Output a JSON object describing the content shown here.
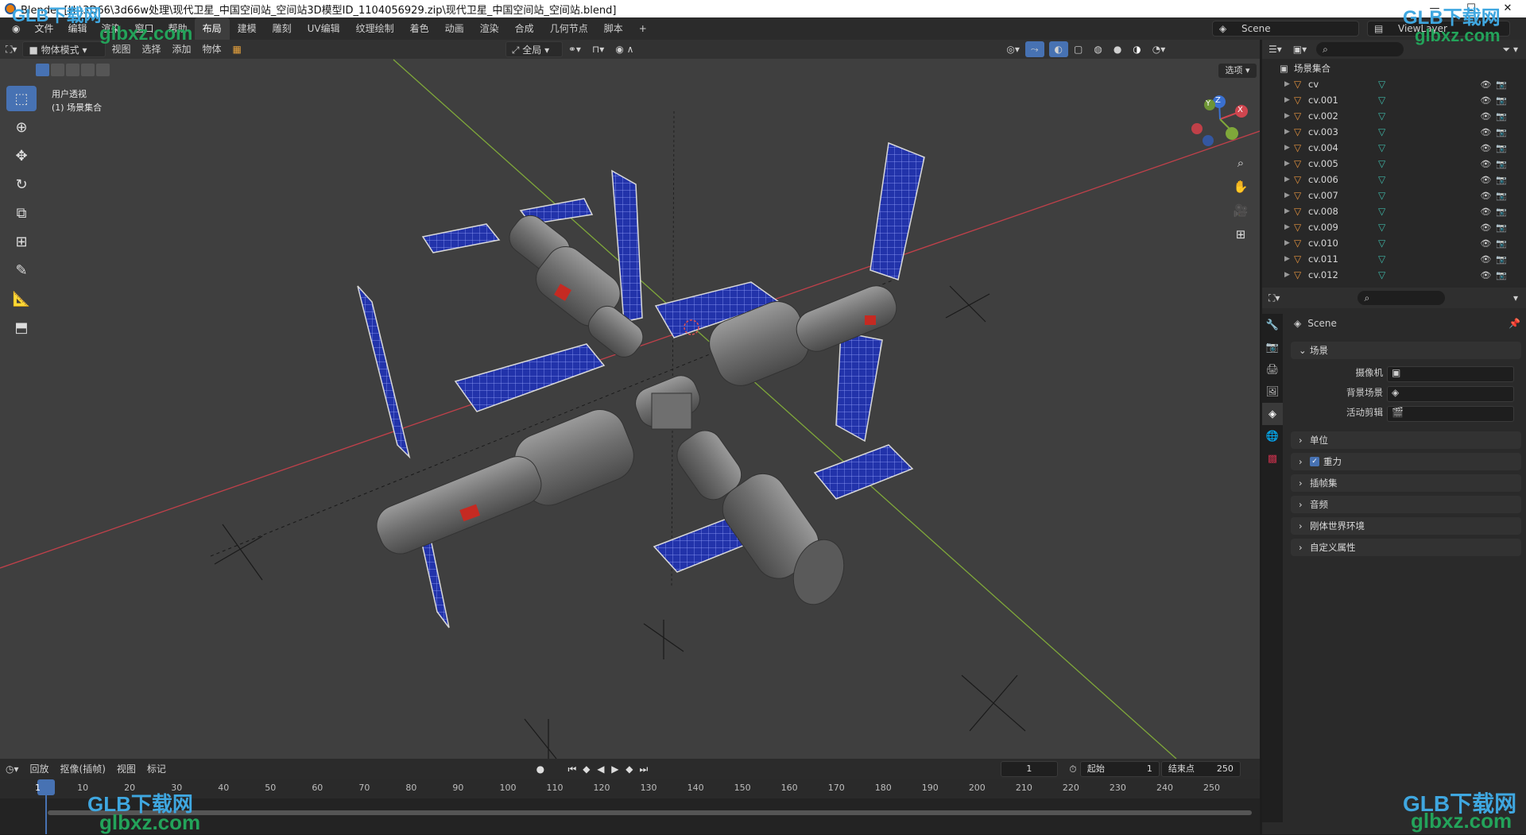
{
  "window": {
    "title": "Blender [H:\\3D66\\3d66w处理\\现代卫星_中国空间站_空间站3D模型ID_1104056929.zip\\现代卫星_中国空间站_空间站.blend]",
    "minimize": "—",
    "maximize": "☐",
    "close": "✕"
  },
  "menu": {
    "items": [
      "文件",
      "编辑",
      "渲染",
      "窗口",
      "帮助"
    ]
  },
  "workspaces": {
    "items": [
      "布局",
      "建模",
      "雕刻",
      "UV编辑",
      "纹理绘制",
      "着色",
      "动画",
      "渲染",
      "合成",
      "几何节点",
      "脚本"
    ],
    "add": "+"
  },
  "scene": {
    "name": "Scene",
    "view_layer": "ViewLayer"
  },
  "viewport": {
    "mode": "物体模式",
    "menus": [
      "视图",
      "选择",
      "添加",
      "物体"
    ],
    "transform_orientation": "全局",
    "view_label": "用户透视",
    "collection_label": "(1) 场景集合",
    "options": "选项",
    "axes": {
      "x": "X",
      "y": "Y",
      "z": "Z"
    },
    "colors": {
      "x_axis": "#d0464f",
      "y_axis": "#7fa83a",
      "solar_panel": "#2233aa",
      "hull": "#7f7f7f",
      "module_red": "#c52a22",
      "bg": "#3f3f3f"
    }
  },
  "tools": [
    "select-box",
    "cursor",
    "move",
    "rotate",
    "scale",
    "transform",
    "annotate",
    "measure",
    "add-cube"
  ],
  "outliner": {
    "root": "场景集合",
    "items": [
      "cv",
      "cv.001",
      "cv.002",
      "cv.003",
      "cv.004",
      "cv.005",
      "cv.006",
      "cv.007",
      "cv.008",
      "cv.009",
      "cv.010",
      "cv.011",
      "cv.012"
    ]
  },
  "properties": {
    "scene_name": "Scene",
    "section_scene": "场景",
    "fields": [
      {
        "label": "摄像机",
        "value": ""
      },
      {
        "label": "背景场景",
        "value": ""
      },
      {
        "label": "活动剪辑",
        "value": ""
      }
    ],
    "sections": [
      "单位",
      "重力",
      "插帧集",
      "音频",
      "刚体世界环境",
      "自定义属性"
    ]
  },
  "timeline": {
    "menus": [
      "回放",
      "抠像(插帧)",
      "视图",
      "标记"
    ],
    "current_frame": "1",
    "start_label": "起始",
    "start": "1",
    "end_label": "结束点",
    "end": "250",
    "ticks": [
      "1",
      "10",
      "20",
      "30",
      "40",
      "50",
      "60",
      "70",
      "80",
      "90",
      "100",
      "110",
      "120",
      "130",
      "140",
      "150",
      "160",
      "170",
      "180",
      "190",
      "200",
      "210",
      "220",
      "230",
      "240",
      "250"
    ]
  },
  "watermark": {
    "brand": "GLB下载网",
    "url": "glbxz.com"
  }
}
